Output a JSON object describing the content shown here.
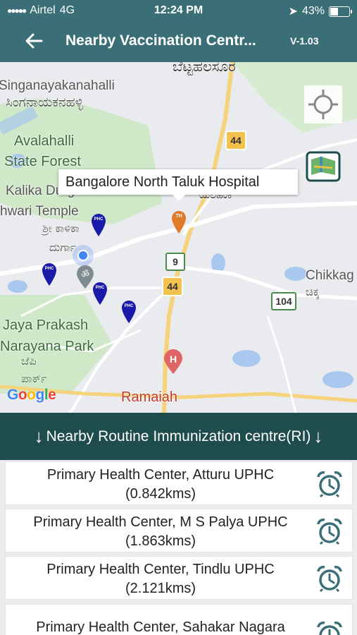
{
  "status": {
    "carrier": "Airtel",
    "network": "4G",
    "time": "12:24 PM",
    "battery": "43%",
    "location_icon": "location-arrow-icon"
  },
  "appbar": {
    "back_icon": "back-arrow-icon",
    "title": "Nearby Vaccination Centr...",
    "version": "V-1.03"
  },
  "map": {
    "callout": "Bangalore North Taluk Hospital",
    "labels": {
      "singanayakanahalli": "Singanayakanahalli",
      "singanayakanahalli_kn": "ಸಿಂಗನಾಯಕನಹಳ್ಳಿ",
      "bettahalasur_kn": "ಬೆಟ್ಟಹಲಸೂರ",
      "avalahalli": "Avalahalli",
      "state_forest": "State Forest",
      "kalika_durga": "Kalika Durga",
      "shwari_temple": "hwari Temple",
      "kalika_kn": "ಶ್ರೀ ಕಾಳಿಕಾ",
      "durga_kn": "ದುರ್ಗಾ",
      "jaya_prakash": "Jaya Prakash",
      "narayana_park": "Narayana Park",
      "jp_kn": "ಜೆಪಿ",
      "park_kn": "ಪಾರ್ಕ್",
      "ramaiah": "Ramaiah",
      "chikka": "Chikkag",
      "chikka_kn": "ಚಿಕ್ಕ",
      "kn_near_hospital": "ಯಲಹಂಕ",
      "hwy_44a": "44",
      "hwy_44b": "44",
      "hwy_9": "9",
      "hwy_104": "104"
    },
    "marker_th": "TH",
    "marker_phc": "PHC",
    "google": "Google"
  },
  "section": {
    "title": "Nearby Routine Immunization centre(RI)",
    "arrow_icon": "arrow-down-icon"
  },
  "centres": [
    {
      "name": "Primary Health Center, Atturu UPHC",
      "distance": "(0.842kms)"
    },
    {
      "name": "Primary Health Center, M S Palya UPHC",
      "distance": "(1.863kms)"
    },
    {
      "name": "Primary Health Center, Tindlu UPHC",
      "distance": "(2.121kms)"
    },
    {
      "name": "Primary Health Center, Sahakar Nagara",
      "distance": ""
    }
  ],
  "colors": {
    "header": "#3b6f78",
    "section": "#1f4c4d",
    "alarm": "#3b6f78",
    "phc_marker": "#1a1aa8",
    "th_marker": "#e07b2c"
  }
}
